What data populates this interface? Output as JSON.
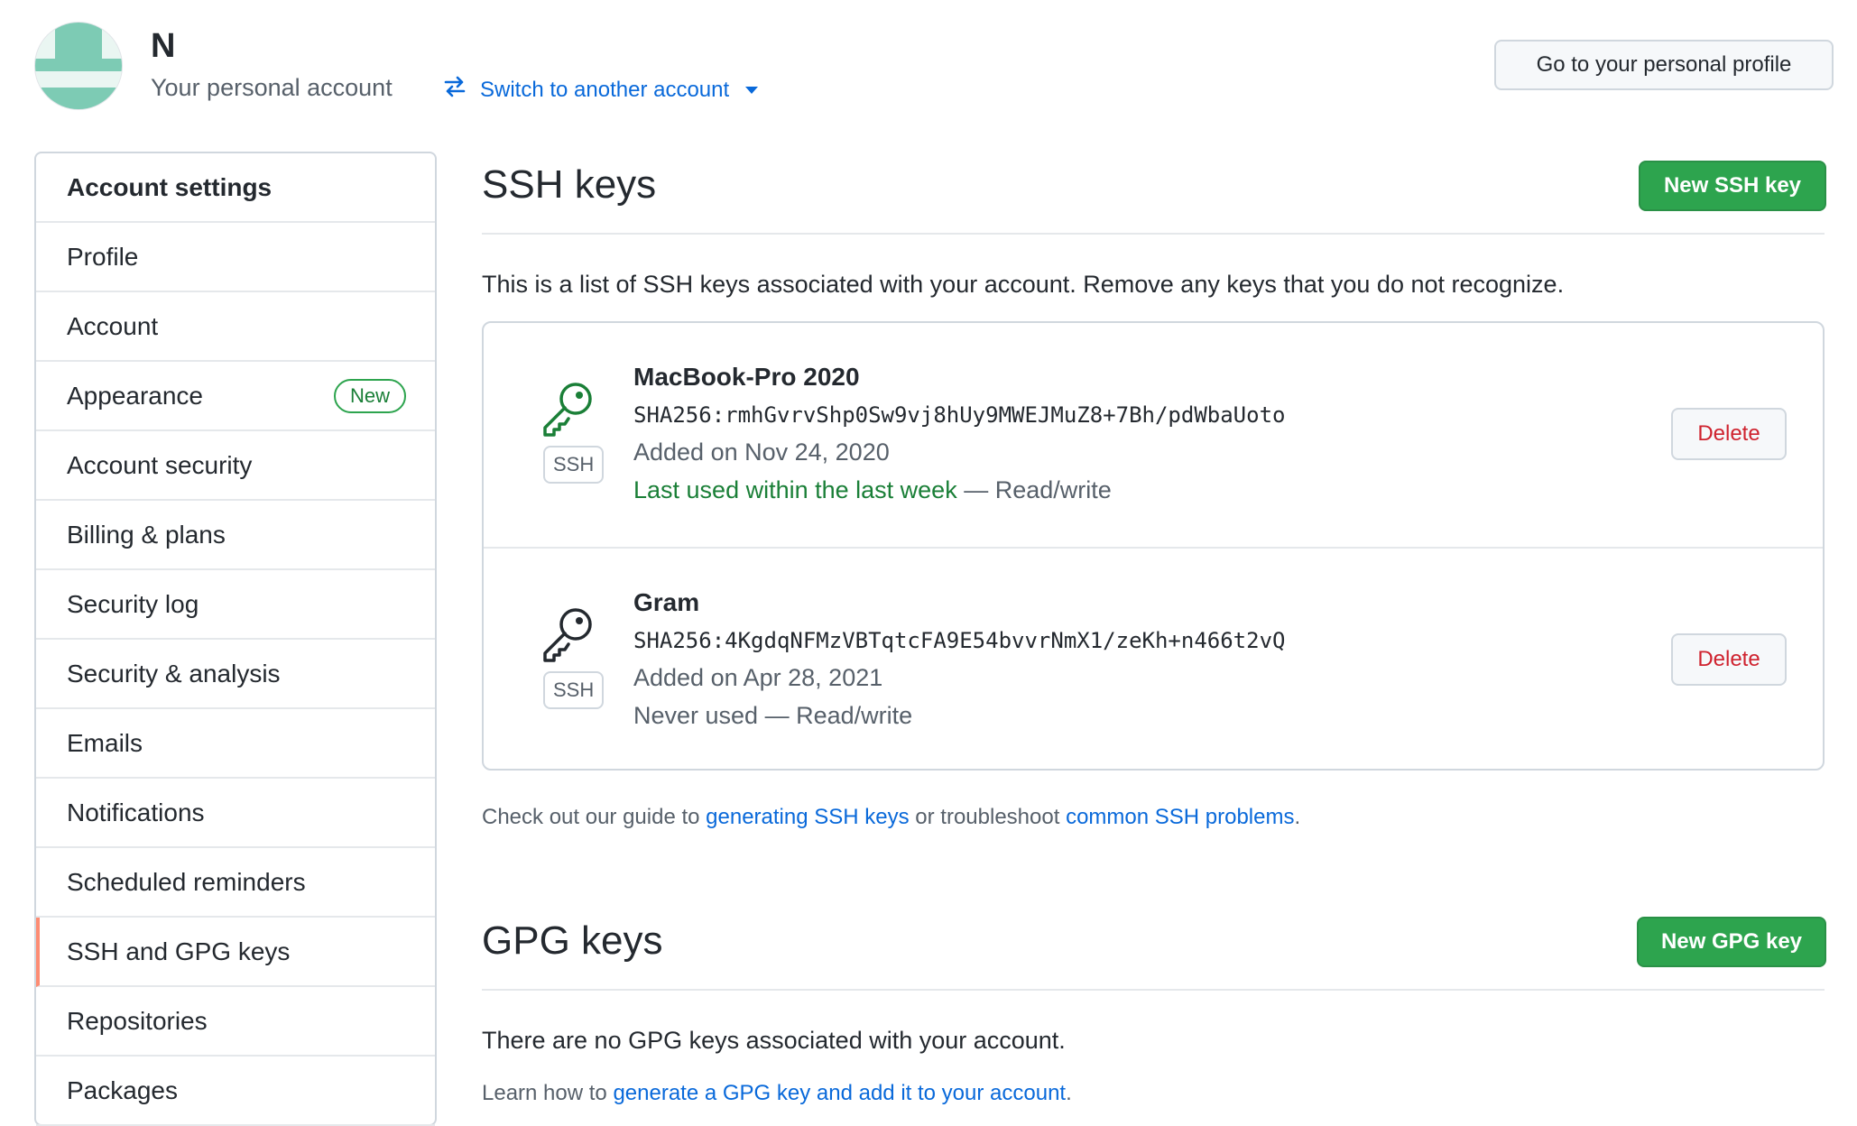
{
  "header": {
    "user_initial": "N",
    "account_label": "Your personal account",
    "switch_label": "Switch to another account",
    "profile_button": "Go to your personal profile"
  },
  "sidebar": {
    "items": [
      {
        "label": "Account settings"
      },
      {
        "label": "Profile"
      },
      {
        "label": "Account"
      },
      {
        "label": "Appearance",
        "badge": "New"
      },
      {
        "label": "Account security"
      },
      {
        "label": "Billing & plans"
      },
      {
        "label": "Security log"
      },
      {
        "label": "Security & analysis"
      },
      {
        "label": "Emails"
      },
      {
        "label": "Notifications"
      },
      {
        "label": "Scheduled reminders"
      },
      {
        "label": "SSH and GPG keys",
        "active": true
      },
      {
        "label": "Repositories"
      },
      {
        "label": "Packages"
      }
    ]
  },
  "ssh": {
    "title": "SSH keys",
    "new_button": "New SSH key",
    "description": "This is a list of SSH keys associated with your account. Remove any keys that you do not recognize.",
    "keys": [
      {
        "name": "MacBook-Pro 2020",
        "fingerprint": "SHA256:rmhGvrvShp0Sw9vj8hUy9MWEJMuZ8+7Bh/pdWbaUoto",
        "added": "Added on Nov 24, 2020",
        "last_used": "Last used within the last week",
        "access": " — Read/write",
        "type_label": "SSH",
        "delete_label": "Delete",
        "icon": "key-icon",
        "icon_color": "#1a7f37"
      },
      {
        "name": "Gram",
        "fingerprint": "SHA256:4KgdqNFMzVBTqtcFA9E54bvvrNmX1/zeKh+n466t2vQ",
        "added": "Added on Apr 28, 2021",
        "last_used": "Never used",
        "access": " — Read/write",
        "type_label": "SSH",
        "delete_label": "Delete",
        "icon": "key-icon",
        "icon_color": "#24292f"
      }
    ],
    "guide_prefix": "Check out our guide to ",
    "guide_link1": "generating SSH keys",
    "guide_middle": " or troubleshoot ",
    "guide_link2": "common SSH problems",
    "guide_suffix": "."
  },
  "gpg": {
    "title": "GPG keys",
    "new_button": "New GPG key",
    "empty_text": "There are no GPG keys associated with your account.",
    "learn_prefix": "Learn how to ",
    "learn_link": "generate a GPG key and add it to your account",
    "learn_suffix": "."
  },
  "colors": {
    "accent_link": "#0969da",
    "primary_button": "#2da44e",
    "danger": "#cf222e",
    "active_indicator": "#fd8c73"
  }
}
